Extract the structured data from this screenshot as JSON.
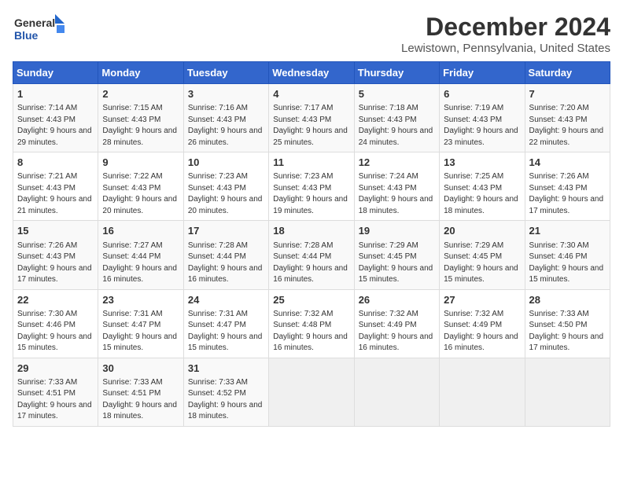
{
  "logo": {
    "line1": "General",
    "line2": "Blue"
  },
  "title": "December 2024",
  "subtitle": "Lewistown, Pennsylvania, United States",
  "days_of_week": [
    "Sunday",
    "Monday",
    "Tuesday",
    "Wednesday",
    "Thursday",
    "Friday",
    "Saturday"
  ],
  "weeks": [
    [
      {
        "day": "1",
        "info": "Sunrise: 7:14 AM\nSunset: 4:43 PM\nDaylight: 9 hours\nand 29 minutes."
      },
      {
        "day": "2",
        "info": "Sunrise: 7:15 AM\nSunset: 4:43 PM\nDaylight: 9 hours\nand 28 minutes."
      },
      {
        "day": "3",
        "info": "Sunrise: 7:16 AM\nSunset: 4:43 PM\nDaylight: 9 hours\nand 26 minutes."
      },
      {
        "day": "4",
        "info": "Sunrise: 7:17 AM\nSunset: 4:43 PM\nDaylight: 9 hours\nand 25 minutes."
      },
      {
        "day": "5",
        "info": "Sunrise: 7:18 AM\nSunset: 4:43 PM\nDaylight: 9 hours\nand 24 minutes."
      },
      {
        "day": "6",
        "info": "Sunrise: 7:19 AM\nSunset: 4:43 PM\nDaylight: 9 hours\nand 23 minutes."
      },
      {
        "day": "7",
        "info": "Sunrise: 7:20 AM\nSunset: 4:43 PM\nDaylight: 9 hours\nand 22 minutes."
      }
    ],
    [
      {
        "day": "8",
        "info": "Sunrise: 7:21 AM\nSunset: 4:43 PM\nDaylight: 9 hours\nand 21 minutes."
      },
      {
        "day": "9",
        "info": "Sunrise: 7:22 AM\nSunset: 4:43 PM\nDaylight: 9 hours\nand 20 minutes."
      },
      {
        "day": "10",
        "info": "Sunrise: 7:23 AM\nSunset: 4:43 PM\nDaylight: 9 hours\nand 20 minutes."
      },
      {
        "day": "11",
        "info": "Sunrise: 7:23 AM\nSunset: 4:43 PM\nDaylight: 9 hours\nand 19 minutes."
      },
      {
        "day": "12",
        "info": "Sunrise: 7:24 AM\nSunset: 4:43 PM\nDaylight: 9 hours\nand 18 minutes."
      },
      {
        "day": "13",
        "info": "Sunrise: 7:25 AM\nSunset: 4:43 PM\nDaylight: 9 hours\nand 18 minutes."
      },
      {
        "day": "14",
        "info": "Sunrise: 7:26 AM\nSunset: 4:43 PM\nDaylight: 9 hours\nand 17 minutes."
      }
    ],
    [
      {
        "day": "15",
        "info": "Sunrise: 7:26 AM\nSunset: 4:43 PM\nDaylight: 9 hours\nand 17 minutes."
      },
      {
        "day": "16",
        "info": "Sunrise: 7:27 AM\nSunset: 4:44 PM\nDaylight: 9 hours\nand 16 minutes."
      },
      {
        "day": "17",
        "info": "Sunrise: 7:28 AM\nSunset: 4:44 PM\nDaylight: 9 hours\nand 16 minutes."
      },
      {
        "day": "18",
        "info": "Sunrise: 7:28 AM\nSunset: 4:44 PM\nDaylight: 9 hours\nand 16 minutes."
      },
      {
        "day": "19",
        "info": "Sunrise: 7:29 AM\nSunset: 4:45 PM\nDaylight: 9 hours\nand 15 minutes."
      },
      {
        "day": "20",
        "info": "Sunrise: 7:29 AM\nSunset: 4:45 PM\nDaylight: 9 hours\nand 15 minutes."
      },
      {
        "day": "21",
        "info": "Sunrise: 7:30 AM\nSunset: 4:46 PM\nDaylight: 9 hours\nand 15 minutes."
      }
    ],
    [
      {
        "day": "22",
        "info": "Sunrise: 7:30 AM\nSunset: 4:46 PM\nDaylight: 9 hours\nand 15 minutes."
      },
      {
        "day": "23",
        "info": "Sunrise: 7:31 AM\nSunset: 4:47 PM\nDaylight: 9 hours\nand 15 minutes."
      },
      {
        "day": "24",
        "info": "Sunrise: 7:31 AM\nSunset: 4:47 PM\nDaylight: 9 hours\nand 15 minutes."
      },
      {
        "day": "25",
        "info": "Sunrise: 7:32 AM\nSunset: 4:48 PM\nDaylight: 9 hours\nand 16 minutes."
      },
      {
        "day": "26",
        "info": "Sunrise: 7:32 AM\nSunset: 4:49 PM\nDaylight: 9 hours\nand 16 minutes."
      },
      {
        "day": "27",
        "info": "Sunrise: 7:32 AM\nSunset: 4:49 PM\nDaylight: 9 hours\nand 16 minutes."
      },
      {
        "day": "28",
        "info": "Sunrise: 7:33 AM\nSunset: 4:50 PM\nDaylight: 9 hours\nand 17 minutes."
      }
    ],
    [
      {
        "day": "29",
        "info": "Sunrise: 7:33 AM\nSunset: 4:51 PM\nDaylight: 9 hours\nand 17 minutes."
      },
      {
        "day": "30",
        "info": "Sunrise: 7:33 AM\nSunset: 4:51 PM\nDaylight: 9 hours\nand 18 minutes."
      },
      {
        "day": "31",
        "info": "Sunrise: 7:33 AM\nSunset: 4:52 PM\nDaylight: 9 hours\nand 18 minutes."
      },
      {
        "day": "",
        "info": ""
      },
      {
        "day": "",
        "info": ""
      },
      {
        "day": "",
        "info": ""
      },
      {
        "day": "",
        "info": ""
      }
    ]
  ]
}
